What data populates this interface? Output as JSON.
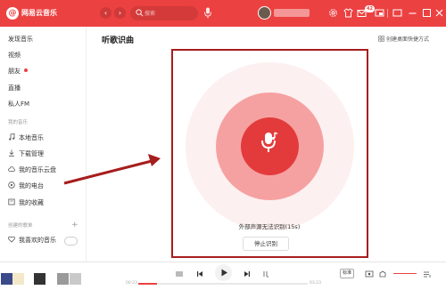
{
  "app": {
    "logo_glyph": "@",
    "title": "网易云音乐"
  },
  "topbar": {
    "search_placeholder": "搜索",
    "message_badge": "42",
    "icons": [
      "back-icon",
      "forward-icon",
      "search-icon",
      "mic-icon",
      "settings-icon",
      "skin-icon",
      "mail-icon",
      "mini-mode-icon",
      "minimize-icon",
      "maximize-icon",
      "close-icon"
    ]
  },
  "sidebar": {
    "items": [
      {
        "label": "发现音乐"
      },
      {
        "label": "视频"
      },
      {
        "label": "朋友"
      },
      {
        "label": "直播"
      },
      {
        "label": "私人FM"
      }
    ],
    "my_music_header": "我的音乐",
    "my_music_items": [
      {
        "label": "本地音乐",
        "icon": "music-note-icon"
      },
      {
        "label": "下载管理",
        "icon": "download-icon"
      },
      {
        "label": "我的音乐云盘",
        "icon": "cloud-icon"
      },
      {
        "label": "我的电台",
        "icon": "radio-icon"
      },
      {
        "label": "我的收藏",
        "icon": "collection-icon"
      }
    ],
    "created_playlists_header": "创建的歌单",
    "playlist_items": [
      {
        "label": "我喜欢的音乐",
        "icon": "heart-icon"
      }
    ]
  },
  "main": {
    "title": "听歌识曲",
    "shortcut_label": "创建桌面快捷方式",
    "status_text": "外部声源无法识别(15s)",
    "stop_button": "停止识别"
  },
  "player": {
    "current_time": "00:23",
    "total_time": "03:23",
    "progress_percent": 11,
    "quality_label": "标准"
  },
  "colors": {
    "accent": "#ec4141",
    "ring_outer": "#fdf0f0",
    "ring_middle": "#f6a1a1",
    "ring_inner": "#e33b3b",
    "annotation": "#a71d1d"
  }
}
